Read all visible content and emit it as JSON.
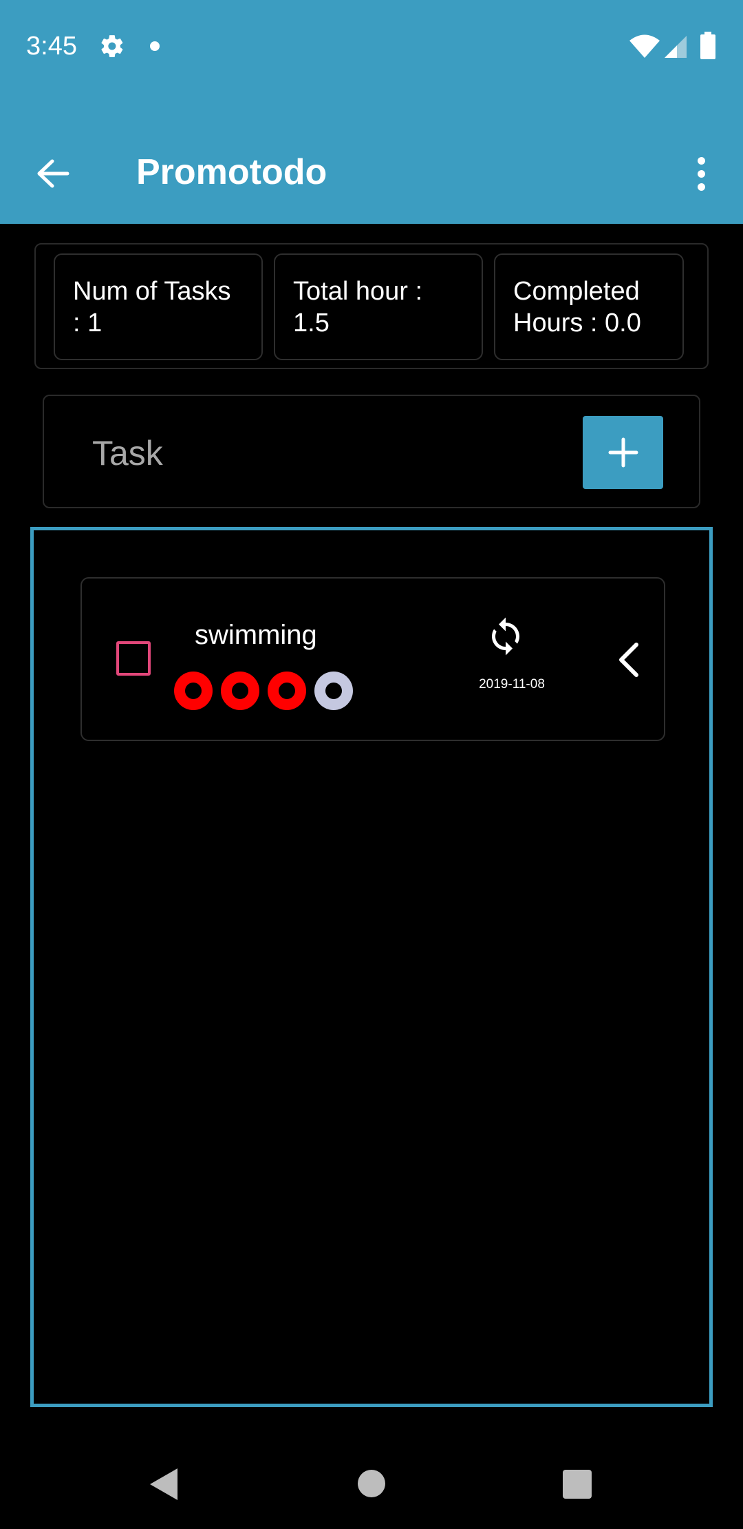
{
  "status_bar": {
    "time": "3:45",
    "icons": [
      "gear-icon",
      "notification-dot-icon",
      "wifi-icon",
      "signal-icon",
      "battery-icon"
    ]
  },
  "app_bar": {
    "title": "Promotodo",
    "back_icon": "arrow-left-icon",
    "menu_icon": "more-vertical-icon"
  },
  "stats": {
    "num_tasks": "Num of Tasks : 1",
    "total_hours": "Total hour : 1.5",
    "completed_hours": "Completed Hours : 0.0"
  },
  "task_entry": {
    "placeholder": "Task",
    "value": "",
    "add_icon": "plus-icon"
  },
  "tasks": [
    {
      "name": "swimming",
      "date": "2019-11-08",
      "checked": false,
      "pomodoros_total": 4,
      "pomodoros_completed": 3,
      "icons": [
        "checkbox-icon",
        "sync-icon",
        "chevron-left-icon"
      ]
    }
  ],
  "nav_bar": {
    "icons": [
      "nav-back-icon",
      "nav-home-icon",
      "nav-recents-icon"
    ]
  },
  "colors": {
    "primary": "#3c9dc1",
    "background": "#000000",
    "pomodoro_pending": "#ff0000",
    "pomodoro_done": "#c5c8e0",
    "checkbox": "#e2477a"
  }
}
